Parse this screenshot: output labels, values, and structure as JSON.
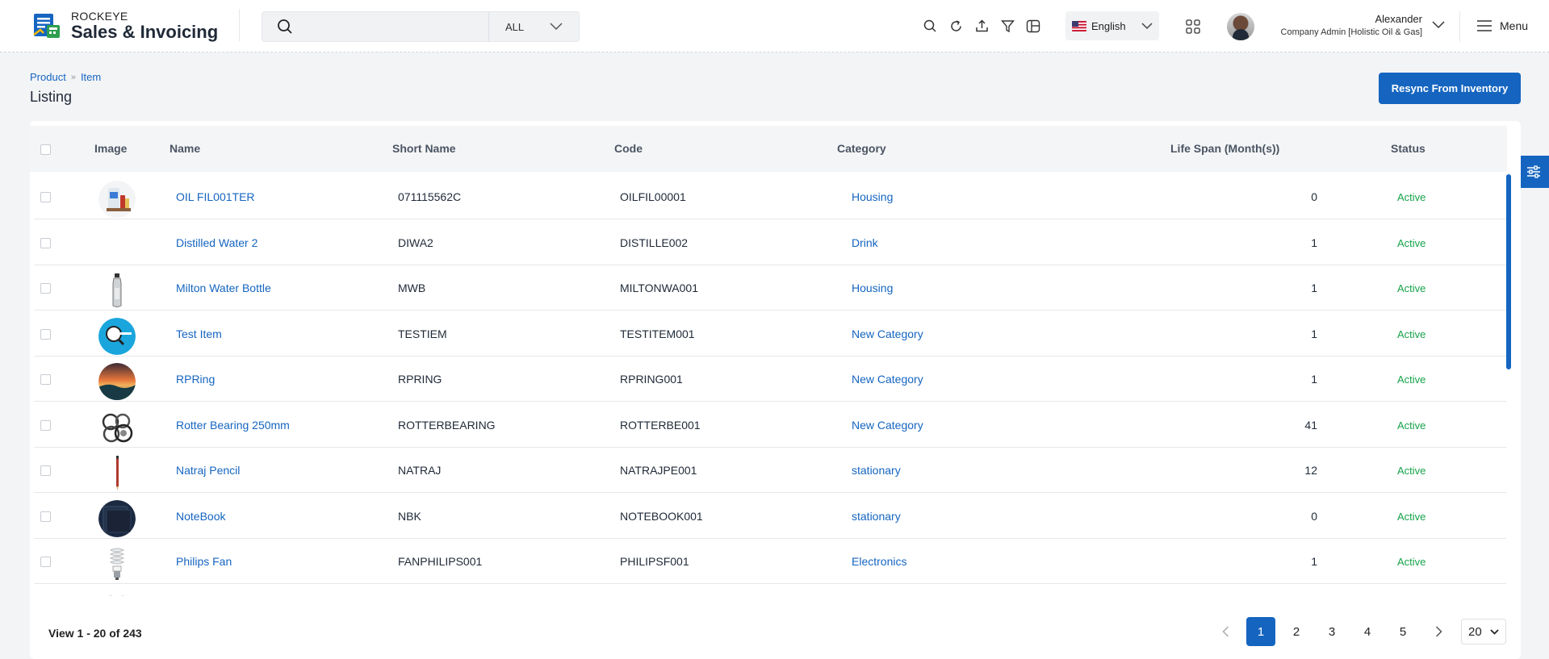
{
  "brand": {
    "top": "ROCKEYE",
    "bottom": "Sales & Invoicing"
  },
  "search": {
    "value": "",
    "placeholder": "",
    "scope": "ALL"
  },
  "header": {
    "icons": [
      "search-icon",
      "refresh-icon",
      "upload-icon",
      "filter-icon",
      "layout-icon"
    ],
    "language": "English",
    "user_name": "Alexander",
    "user_role": "Company Admin [Holistic Oil & Gas]",
    "menu_label": "Menu"
  },
  "breadcrumb": {
    "items": [
      "Product",
      "Item"
    ]
  },
  "page": {
    "title": "Listing",
    "resync_label": "Resync From Inventory"
  },
  "table": {
    "headers": {
      "image": "Image",
      "name": "Name",
      "short_name": "Short Name",
      "code": "Code",
      "category": "Category",
      "life_span": "Life Span (Month(s))",
      "status": "Status"
    },
    "rows": [
      {
        "name": "OIL FIL001TER",
        "short_name": "071115562C",
        "code": "OILFIL00001",
        "category": "Housing",
        "life_span": "0",
        "status": "Active",
        "image": "oil-filter"
      },
      {
        "name": "Distilled Water 2",
        "short_name": "DIWA2",
        "code": "DISTILLE002",
        "category": "Drink",
        "life_span": "1",
        "status": "Active",
        "image": "none"
      },
      {
        "name": "Milton Water Bottle",
        "short_name": "MWB",
        "code": "MILTONWA001",
        "category": "Housing",
        "life_span": "1",
        "status": "Active",
        "image": "bottle"
      },
      {
        "name": "Test Item",
        "short_name": "TESTIEM",
        "code": "TESTITEM001",
        "category": "New Category",
        "life_span": "1",
        "status": "Active",
        "image": "search-badge"
      },
      {
        "name": "RPRing",
        "short_name": "RPRING",
        "code": "RPRING001",
        "category": "New Category",
        "life_span": "1",
        "status": "Active",
        "image": "sunset"
      },
      {
        "name": "Rotter Bearing 250mm",
        "short_name": "ROTTERBEARING",
        "code": "ROTTERBE001",
        "category": "New Category",
        "life_span": "41",
        "status": "Active",
        "image": "bearing"
      },
      {
        "name": "Natraj Pencil",
        "short_name": "NATRAJ",
        "code": "NATRAJPE001",
        "category": "stationary",
        "life_span": "12",
        "status": "Active",
        "image": "pencil"
      },
      {
        "name": "NoteBook",
        "short_name": "NBK",
        "code": "NOTEBOOK001",
        "category": "stationary",
        "life_span": "0",
        "status": "Active",
        "image": "notebook"
      },
      {
        "name": "Philips Fan",
        "short_name": "FANPHILIPS001",
        "code": "PHILIPSF001",
        "category": "Electronics",
        "life_span": "1",
        "status": "Active",
        "image": "bulb"
      }
    ]
  },
  "pagination": {
    "info": "View 1 - 20 of 243",
    "pages": [
      "1",
      "2",
      "3",
      "4",
      "5"
    ],
    "current": "1",
    "page_size": "20"
  },
  "colors": {
    "accent": "#1565c0",
    "status_active": "#16a34a"
  }
}
